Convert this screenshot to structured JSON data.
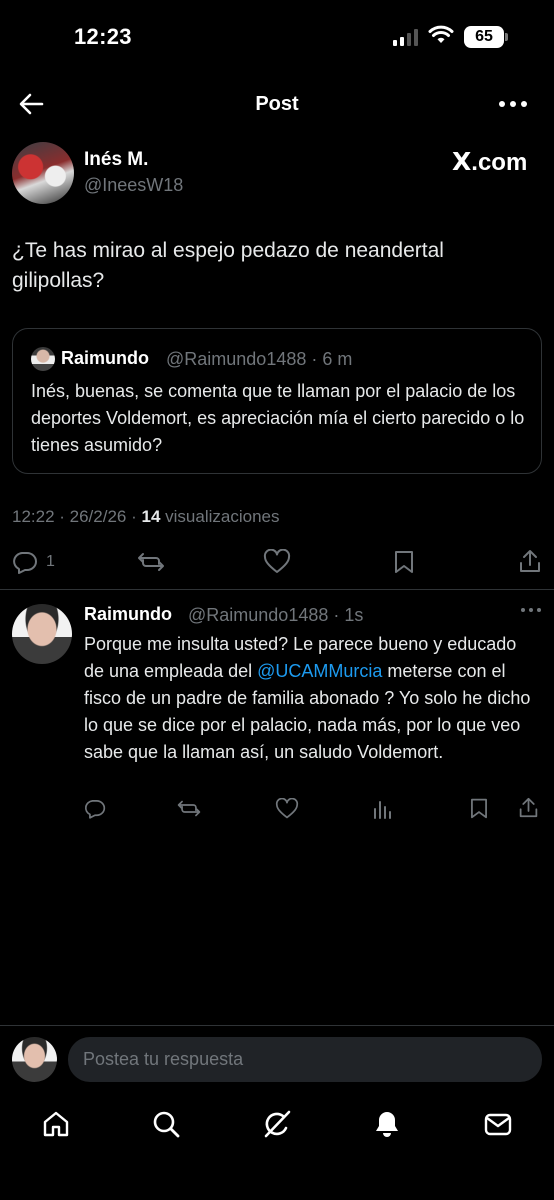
{
  "status_bar": {
    "time": "12:23",
    "battery": "65"
  },
  "header": {
    "title": "Post"
  },
  "post": {
    "author_name": "Inés M.",
    "author_handle": "@IneesW18",
    "brand": "X",
    "brand_suffix": ".com",
    "text": "¿Te has mirao al espejo pedazo de neandertal gilipollas?",
    "timestamp": "12:22 · 26/2/26 · ",
    "views_count": "14",
    "views_label": "visualizaciones",
    "reply_count": "1"
  },
  "quote": {
    "name": "Raimundo",
    "handle": "@Raimundo1488 · 6 m",
    "text": "Inés, buenas, se comenta que te llaman por el palacio de los deportes Voldemort, es apreciación mía el cierto parecido o lo tienes asumido?"
  },
  "reply": {
    "name": "Raimundo",
    "handle": "@Raimundo1488 · 1s",
    "text_before": "Porque me insulta usted? Le parece bueno y educado de una empleada del ",
    "mention": "@UCAMMurcia",
    "text_after": " meterse con el fisco de un padre de familia abonado ? Yo solo he dicho lo que se dice por el palacio, nada más, por lo que veo sabe que la llaman así, un saludo Voldemort."
  },
  "compose": {
    "placeholder": "Postea tu respuesta"
  },
  "colors": {
    "accent": "#1d9bf0",
    "muted": "#71767b",
    "background": "#000000",
    "border": "#2f3336"
  },
  "icons": [
    "back-arrow-icon",
    "more-icon",
    "reply-icon",
    "repost-icon",
    "like-icon",
    "bookmark-icon",
    "share-icon",
    "views-icon",
    "home-icon",
    "search-icon",
    "grok-icon",
    "notifications-icon",
    "messages-icon"
  ]
}
